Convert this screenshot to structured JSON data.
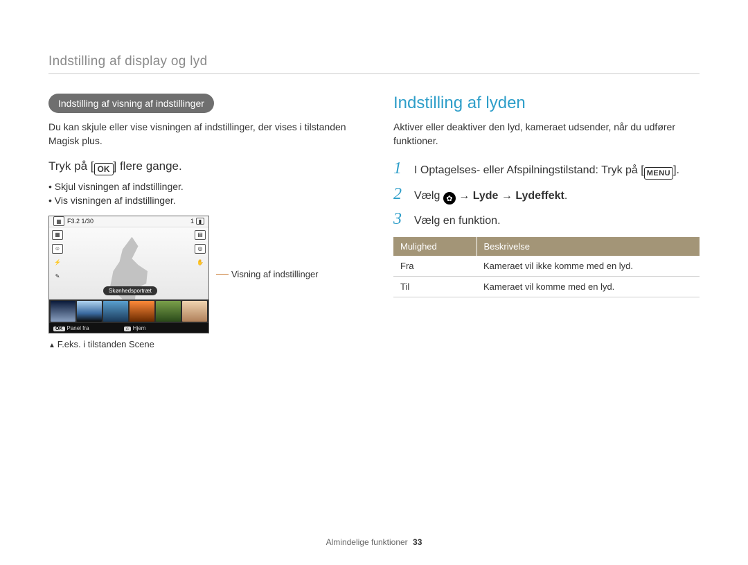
{
  "header": "Indstilling af display og lyd",
  "left": {
    "pill": "Indstilling af visning af indstillinger",
    "intro": "Du kan skjule eller vise visningen af indstillinger, der vises i tilstanden Magisk plus.",
    "press_pre": "Tryk på [",
    "press_btn": "OK",
    "press_post": "] flere gange.",
    "bullets": [
      "Skjul visningen af indstillinger.",
      "Vis visningen af indstillinger."
    ],
    "cam": {
      "top_left": "F3.2 1/30",
      "top_right": "1",
      "mode_label": "Skønhedsportræt",
      "bottom_left_btn": "OK",
      "bottom_left_text": "Panel fra",
      "bottom_right_text": "Hjem"
    },
    "leader": "Visning af indstillinger",
    "caption": "F.eks. i tilstanden Scene"
  },
  "right": {
    "title": "Indstilling af lyden",
    "intro": "Aktiver eller deaktiver den lyd, kameraet udsender, når du udfører funktioner.",
    "step1_pre": "I Optagelses- eller Afspilningstilstand: Tryk på [",
    "step1_btn": "MENU",
    "step1_post": "].",
    "step2_pre": "Vælg ",
    "step2_b1": "Lyde",
    "step2_b2": "Lydeffekt",
    "step3": "Vælg en funktion.",
    "table": {
      "h1": "Mulighed",
      "h2": "Beskrivelse",
      "rows": [
        {
          "opt": "Fra",
          "desc": "Kameraet vil ikke komme med en lyd."
        },
        {
          "opt": "Til",
          "desc": "Kameraet vil komme med en lyd."
        }
      ]
    }
  },
  "footer": {
    "section": "Almindelige funktioner",
    "page": "33"
  }
}
